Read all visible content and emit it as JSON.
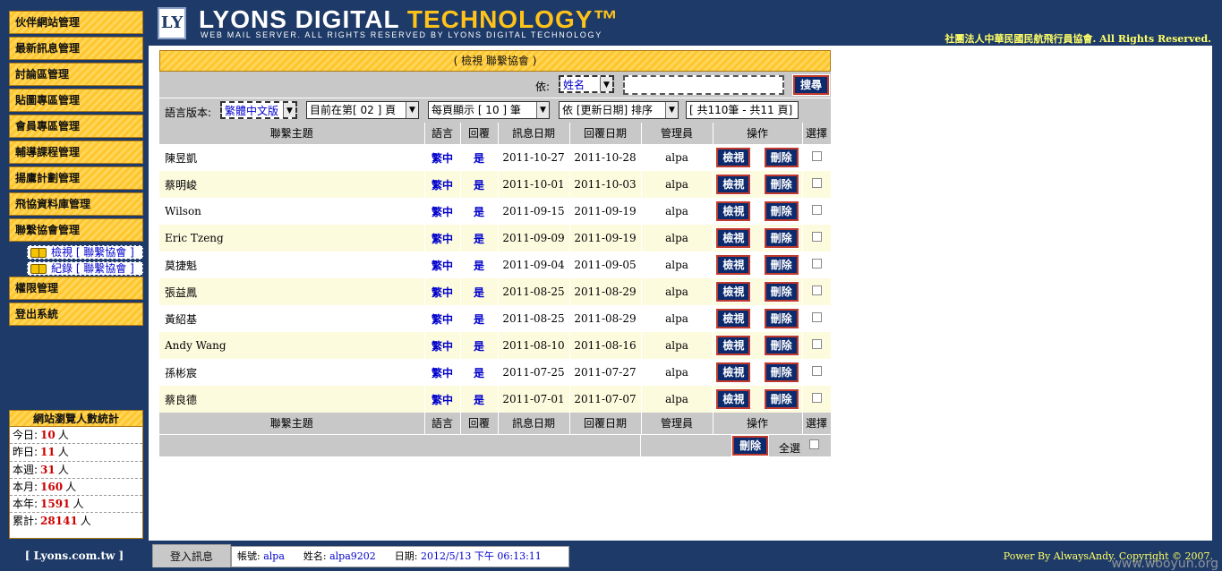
{
  "header": {
    "brand_main": "LYONS DIGITAL ",
    "brand_accent": "TECHNOLOGY™",
    "brand_sub": "WEB MAIL SERVER. ALL RIGHTS RESERVED BY LYONS DIGITAL TECHNOLOGY",
    "logo_text": "LY",
    "rights": "社團法人中華民國民航飛行員協會. All Rights Reserved."
  },
  "sidebar": {
    "items": [
      {
        "label": "伙伴網站管理"
      },
      {
        "label": "最新訊息管理"
      },
      {
        "label": "討論區管理"
      },
      {
        "label": "貼圖專區管理"
      },
      {
        "label": "會員專區管理"
      },
      {
        "label": "輔導課程管理"
      },
      {
        "label": "揚鷹計劃管理"
      },
      {
        "label": "飛協資料庫管理"
      },
      {
        "label": "聯繫協會管理"
      },
      {
        "label": "權限管理"
      },
      {
        "label": "登出系統"
      }
    ],
    "sub_items": [
      {
        "label": "檢視 [ 聯繫協會 ]"
      },
      {
        "label": "紀錄 [ 聯繫協會 ]"
      }
    ]
  },
  "stats": {
    "title": "網站瀏覽人數統計",
    "rows": [
      {
        "label": "今日:",
        "value": "10",
        "unit": "人"
      },
      {
        "label": "昨日:",
        "value": "11",
        "unit": "人"
      },
      {
        "label": "本週:",
        "value": "31",
        "unit": "人"
      },
      {
        "label": "本月:",
        "value": "160",
        "unit": "人"
      },
      {
        "label": "本年:",
        "value": "1591",
        "unit": "人"
      },
      {
        "label": "累計:",
        "value": "28141",
        "unit": "人"
      }
    ]
  },
  "panel": {
    "title": "( 檢視 聯繫協會 )",
    "search_label": "依:",
    "search_field": "姓名",
    "search_value": "",
    "search_button": "搜尋",
    "lang_label": "語言版本:",
    "lang_select": "繁體中文版",
    "page_select": "目前在第[ 02 ] 頁",
    "per_page_select": "每頁顯示 [ 10 ] 筆",
    "sort_select": "依 [更新日期] 排序",
    "total_info": "[ 共110筆 - 共11 頁]"
  },
  "table": {
    "headers": [
      "聯繫主題",
      "語言",
      "回覆",
      "訊息日期",
      "回覆日期",
      "管理員",
      "操作",
      "選擇"
    ],
    "view_label": "檢視",
    "delete_label": "刪除",
    "rows": [
      {
        "topic": "陳昱凱",
        "lang": "繁中",
        "reply": "是",
        "msg_date": "2011-10-27",
        "reply_date": "2011-10-28",
        "admin": "alpa"
      },
      {
        "topic": "蔡明峻",
        "lang": "繁中",
        "reply": "是",
        "msg_date": "2011-10-01",
        "reply_date": "2011-10-03",
        "admin": "alpa"
      },
      {
        "topic": "Wilson",
        "lang": "繁中",
        "reply": "是",
        "msg_date": "2011-09-15",
        "reply_date": "2011-09-19",
        "admin": "alpa"
      },
      {
        "topic": "Eric Tzeng",
        "lang": "繁中",
        "reply": "是",
        "msg_date": "2011-09-09",
        "reply_date": "2011-09-19",
        "admin": "alpa"
      },
      {
        "topic": "莫捷魁",
        "lang": "繁中",
        "reply": "是",
        "msg_date": "2011-09-04",
        "reply_date": "2011-09-05",
        "admin": "alpa"
      },
      {
        "topic": "張益鳳",
        "lang": "繁中",
        "reply": "是",
        "msg_date": "2011-08-25",
        "reply_date": "2011-08-29",
        "admin": "alpa"
      },
      {
        "topic": "黃紹基",
        "lang": "繁中",
        "reply": "是",
        "msg_date": "2011-08-25",
        "reply_date": "2011-08-29",
        "admin": "alpa"
      },
      {
        "topic": "Andy Wang",
        "lang": "繁中",
        "reply": "是",
        "msg_date": "2011-08-10",
        "reply_date": "2011-08-16",
        "admin": "alpa"
      },
      {
        "topic": "孫彬宸",
        "lang": "繁中",
        "reply": "是",
        "msg_date": "2011-07-25",
        "reply_date": "2011-07-27",
        "admin": "alpa"
      },
      {
        "topic": "蔡良德",
        "lang": "繁中",
        "reply": "是",
        "msg_date": "2011-07-01",
        "reply_date": "2011-07-07",
        "admin": "alpa"
      }
    ],
    "footer_delete": "刪除",
    "select_all": "全選"
  },
  "bottom": {
    "site_link": "[ Lyons.com.tw ]",
    "login_tab": "登入訊息",
    "account_label": "帳號:",
    "account": "alpa",
    "name_label": "姓名:",
    "name": "alpa9202",
    "date_label": "日期:",
    "date": "2012/5/13 下午 06:13:11",
    "powered": "Power By AlwaysAndy. Copyright © 2007.",
    "watermark": "www.wooyun.org"
  },
  "colors": {
    "navy": "#1e3a68",
    "gold": "#ffc52c",
    "button": "#0c2b6e",
    "button_border": "#c0392b"
  }
}
